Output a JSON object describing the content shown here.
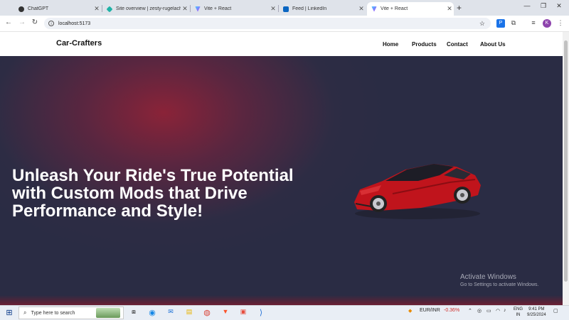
{
  "browser": {
    "tabs": [
      {
        "title": "ChatGPT",
        "icon": "chatgpt-icon",
        "color": "#202123"
      },
      {
        "title": "Site overview | zesty-rugelach-...",
        "icon": "netlify-icon",
        "color": "#20b2a6"
      },
      {
        "title": "Vite + React",
        "icon": "vite-icon",
        "color": "#8f62ff"
      },
      {
        "title": "Feed | LinkedIn",
        "icon": "linkedin-icon",
        "color": "#0a66c2"
      },
      {
        "title": "Vite + React",
        "icon": "vite-icon",
        "color": "#8f62ff",
        "active": true
      }
    ],
    "url": "localhost:5173",
    "profile_initial": "K"
  },
  "site": {
    "brand": "Car-Crafters",
    "nav": [
      "Home",
      "Products",
      "Contact",
      "About Us"
    ],
    "headline": "Unleash Your Ride's True Potential with Custom Mods that Drive Performance and Style!"
  },
  "overlay": {
    "activate_title": "Activate Windows",
    "activate_sub": "Go to Settings to activate Windows."
  },
  "taskbar": {
    "search_placeholder": "Type here to search",
    "currency": "EUR/INR",
    "currency_change": "-0.36%",
    "lang_1": "ENG",
    "lang_2": "IN",
    "time": "9:41 PM",
    "date": "9/25/2024"
  }
}
